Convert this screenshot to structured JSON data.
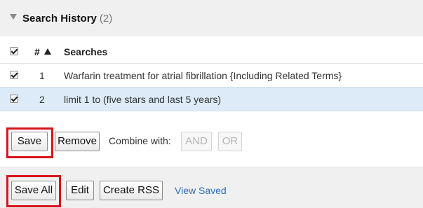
{
  "header": {
    "title": "Search History",
    "count": "(2)"
  },
  "table": {
    "col_num": "#",
    "col_searches": "Searches",
    "rows": [
      {
        "num": "1",
        "query": "Warfarin treatment for atrial fibrillation {Including Related Terms}",
        "selected": false
      },
      {
        "num": "2",
        "query": "limit 1 to (five stars and last 5 years)",
        "selected": true
      }
    ]
  },
  "actions": {
    "save": "Save",
    "remove": "Remove",
    "combine_label": "Combine with:",
    "and": "AND",
    "or": "OR"
  },
  "footer": {
    "save_all": "Save All",
    "edit": "Edit",
    "create_rss": "Create RSS",
    "view_saved": "View Saved"
  },
  "colors": {
    "highlight": "#d9131a",
    "selected_row": "#dcebf7",
    "link": "#2a6ebb"
  }
}
